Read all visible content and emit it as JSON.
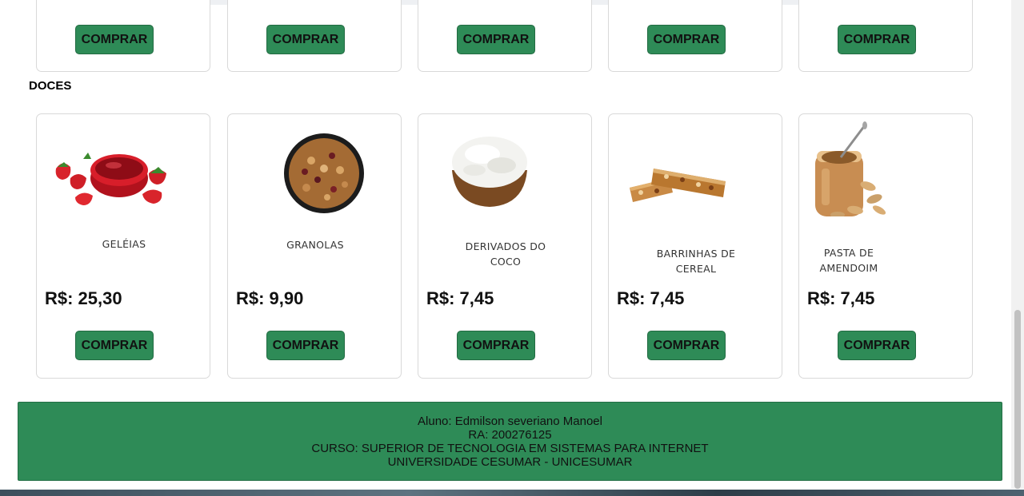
{
  "top_row": {
    "buttons": [
      "COMPRAR",
      "COMPRAR",
      "COMPRAR",
      "COMPRAR",
      "COMPRAR"
    ]
  },
  "section": {
    "title": "DOCES"
  },
  "products": [
    {
      "name_line1": "GELÉIAS",
      "name_line2": "",
      "price": "R$: 25,30",
      "button": "COMPRAR",
      "icon": "jam-bowl-strawberries-image"
    },
    {
      "name_line1": "GRANOLAS",
      "name_line2": "",
      "price": "R$: 9,90",
      "button": "COMPRAR",
      "icon": "granola-bowl-image"
    },
    {
      "name_line1": "DERIVADOS DO",
      "name_line2": "COCO",
      "price": "R$: 7,45",
      "button": "COMPRAR",
      "icon": "grated-coconut-image"
    },
    {
      "name_line1": "BARRINHAS DE",
      "name_line2": "CEREAL",
      "price": "R$: 7,45",
      "button": "COMPRAR",
      "icon": "cereal-bar-image"
    },
    {
      "name_line1": "PASTA DE",
      "name_line2": "AMENDOIM",
      "price": "R$: 7,45",
      "button": "COMPRAR",
      "icon": "peanut-butter-jar-image"
    }
  ],
  "footer": {
    "line1": "Aluno: Edmilson severiano Manoel",
    "line2": "RA: 200276125",
    "line3": "CURSO: SUPERIOR DE TECNOLOGIA EM SISTEMAS PARA INTERNET",
    "line4": "UNIVERSIDADE CESUMAR - UNICESUMAR"
  },
  "colors": {
    "button_green": "#2e8b57",
    "footer_green": "#2e8b57",
    "card_border": "#d9d9d9"
  }
}
